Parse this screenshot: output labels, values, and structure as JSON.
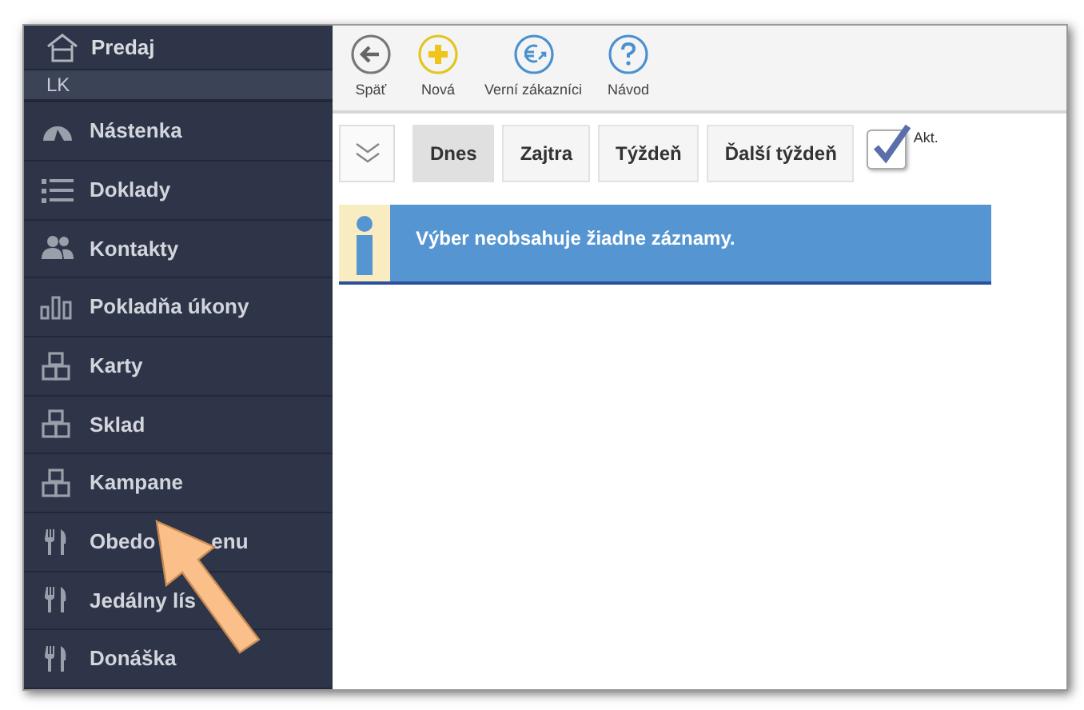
{
  "sidebar": {
    "header": {
      "label": "Predaj",
      "subtitle": "LK"
    },
    "items": [
      {
        "label": "Nástenka",
        "kind": "gauge"
      },
      {
        "label": "Doklady",
        "kind": "list"
      },
      {
        "label": "Kontakty",
        "kind": "people"
      },
      {
        "label": "Pokladňa úkony",
        "kind": "bars"
      },
      {
        "label": "Karty",
        "kind": "boxes"
      },
      {
        "label": "Sklad",
        "kind": "boxes"
      },
      {
        "label": "Kampane",
        "kind": "boxes"
      },
      {
        "label": "Obedo",
        "label_tail": "enu",
        "kind": "cutlery"
      },
      {
        "label": "Jedálny lís",
        "kind": "cutlery"
      },
      {
        "label": "Donáška",
        "kind": "cutlery"
      }
    ]
  },
  "toolbar": [
    {
      "label": "Späť",
      "kind": "back"
    },
    {
      "label": "Nová",
      "kind": "plus"
    },
    {
      "label": "Verní zákazníci",
      "kind": "euro"
    },
    {
      "label": "Návod",
      "kind": "help"
    }
  ],
  "filters": [
    {
      "label": "Dnes",
      "selected": true
    },
    {
      "label": "Zajtra",
      "selected": false
    },
    {
      "label": "Týždeň",
      "selected": false
    },
    {
      "label": "Ďalší týždeň",
      "selected": false
    }
  ],
  "active_checkbox": {
    "label": "Akt.",
    "checked": true
  },
  "info_message": "Výber neobsahuje žiadne záznamy."
}
